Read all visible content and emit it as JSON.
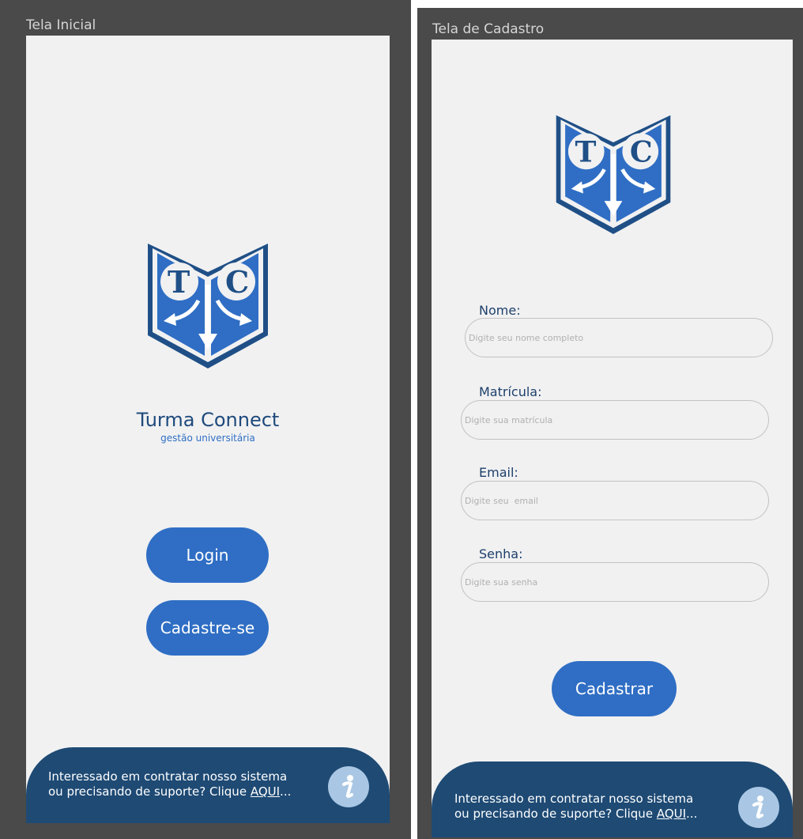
{
  "home": {
    "frame_title": "Tela Inicial",
    "logo_letters": [
      "T",
      "C"
    ],
    "brand_name": "Turma Connect",
    "brand_tagline": "gestão universitária",
    "login_label": "Login",
    "signup_label": "Cadastre-se",
    "footer": {
      "line1": "Interessado em contratar nosso sistema",
      "line2_prefix": "ou precisando de suporte? Clique ",
      "link_label": "AQUI",
      "ellipsis": "...",
      "info_icon": "info-icon"
    }
  },
  "signup": {
    "frame_title": "Tela de Cadastro",
    "logo_letters": [
      "T",
      "C"
    ],
    "fields": [
      {
        "label": "Nome:",
        "placeholder": "Digite seu nome completo"
      },
      {
        "label": "Matrícula:",
        "placeholder": "Digite sua matrícula"
      },
      {
        "label": "Email:",
        "placeholder": "Digite seu  email"
      },
      {
        "label": "Senha:",
        "placeholder": "Digite sua senha"
      }
    ],
    "submit_label": "Cadastrar",
    "footer": {
      "line1": "Interessado em contratar nosso sistema",
      "line2_prefix": "ou precisando de suporte? Clique ",
      "link_label": "AQUI",
      "ellipsis": "...",
      "info_icon": "info-icon"
    }
  },
  "colors": {
    "primary_blue": "#2f6ec4",
    "footer_navy": "#1e4a74",
    "screen_bg": "#f1f1f2",
    "frame_bg": "#4a4a4a"
  }
}
